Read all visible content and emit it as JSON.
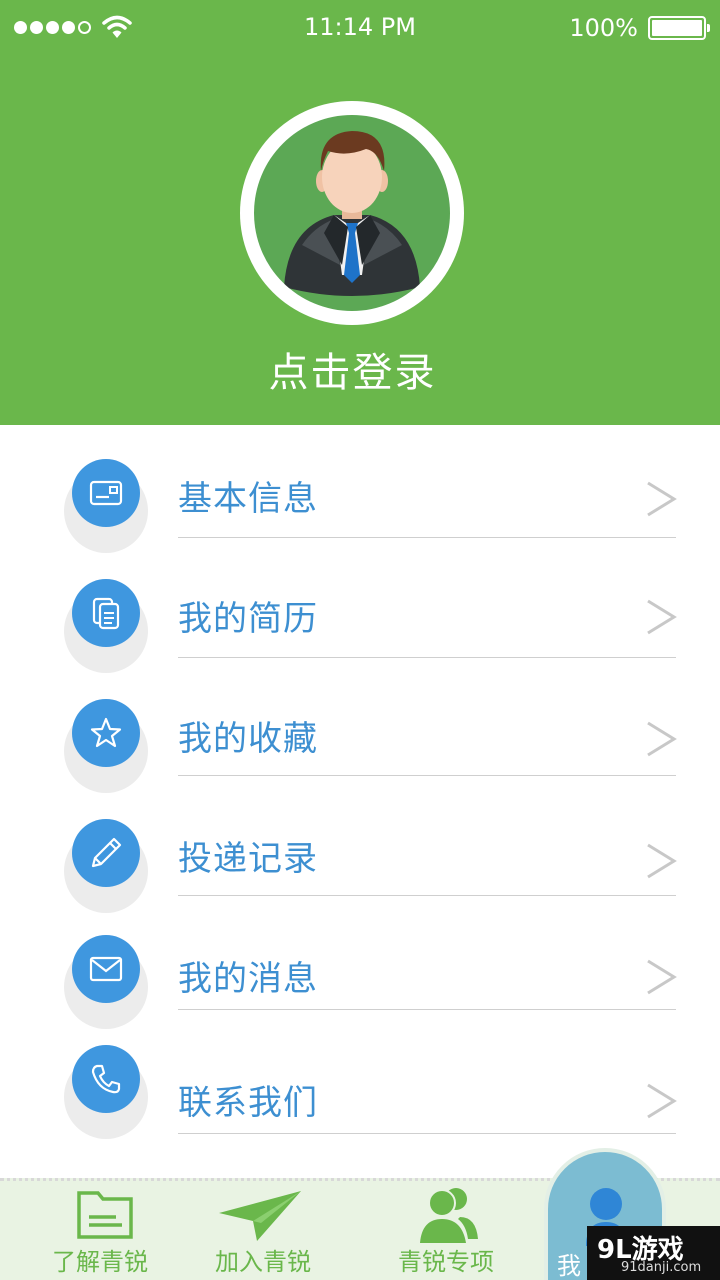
{
  "status_bar": {
    "time": "11:14 PM",
    "battery_percent": "100%",
    "signal_bars_filled": 4,
    "signal_bars_total": 5
  },
  "profile": {
    "avatar_icon": "businessman-avatar-icon",
    "login_text": "点击登录"
  },
  "menu": {
    "items": [
      {
        "label": "基本信息",
        "icon": "id-card-icon"
      },
      {
        "label": "我的简历",
        "icon": "document-icon"
      },
      {
        "label": "我的收藏",
        "icon": "star-icon"
      },
      {
        "label": "投递记录",
        "icon": "pencil-icon"
      },
      {
        "label": "我的消息",
        "icon": "envelope-icon"
      },
      {
        "label": "联系我们",
        "icon": "phone-icon"
      }
    ],
    "chevron": ">"
  },
  "tabbar": {
    "tabs": [
      {
        "label": "了解青锐",
        "icon": "folder-icon"
      },
      {
        "label": "加入青锐",
        "icon": "paper-plane-icon"
      },
      {
        "label": "青锐专项",
        "icon": "users-icon"
      },
      {
        "label": "我",
        "icon": "person-icon",
        "active": true
      }
    ]
  },
  "watermark": {
    "main": "9L游戏",
    "sub": "91danji.com"
  },
  "colors": {
    "header_green": "#6ab74b",
    "icon_blue": "#3f97df",
    "label_blue": "#3d8fd1",
    "tabbar_bg": "#e9f3e3"
  }
}
